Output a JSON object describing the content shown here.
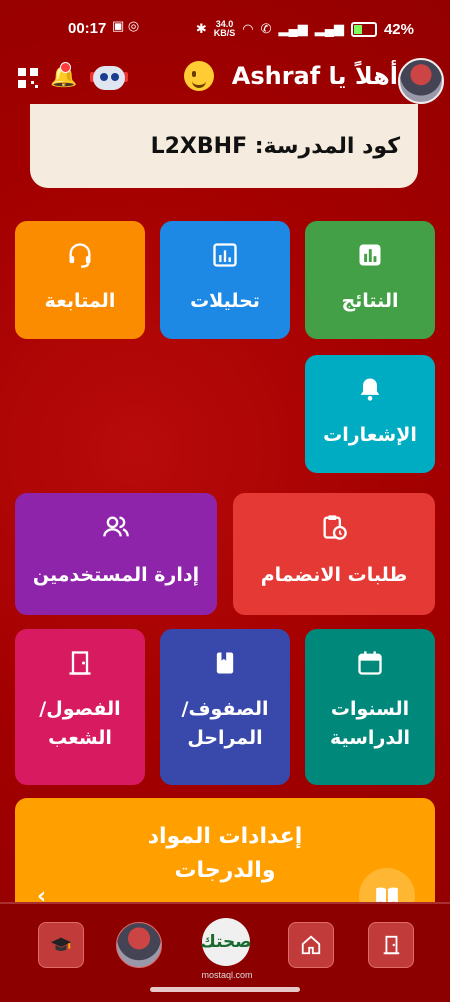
{
  "status_bar": {
    "time": "00:17",
    "speed": "34.0",
    "speed_unit": "KB/S",
    "battery": "42%"
  },
  "header": {
    "greeting": "أهلاً يا Ashraf"
  },
  "school": {
    "code_text": "كود المدرسة: L2XBHF"
  },
  "tiles": {
    "results": {
      "label": "النتائج",
      "color": "#43a047",
      "icon": "bar-chart-icon"
    },
    "analytics": {
      "label": "تحليلات",
      "color": "#1e88e5",
      "icon": "analytics-icon"
    },
    "followup": {
      "label": "المتابعة",
      "color": "#fb8c00",
      "icon": "headset-icon"
    },
    "notifications": {
      "label": "الإشعارات",
      "color": "#00acc1",
      "icon": "bell-icon"
    },
    "join_requests": {
      "label": "طلبات الانضمام",
      "color": "#e53935",
      "icon": "clipboard-clock-icon"
    },
    "user_management": {
      "label": "إدارة المستخدمين",
      "color": "#8e24aa",
      "icon": "users-icon"
    },
    "academic_years": {
      "line1": "السنوات",
      "line2": "الدراسية",
      "color": "#00897b",
      "icon": "calendar-icon"
    },
    "grades_stages": {
      "line1": "الصفوف/",
      "line2": "المراحل",
      "color": "#3949ab",
      "icon": "book-icon"
    },
    "classes_sections": {
      "line1": "الفصول/",
      "line2": "الشعب",
      "color": "#d81b60",
      "icon": "door-icon"
    },
    "subjects_settings": {
      "line1": "إعدادات المواد",
      "line2": "والدرجات",
      "color": "#ffa000",
      "icon": "open-book-icon"
    }
  },
  "bottom_nav": {
    "items": [
      "graduation-cap-icon",
      "profile-avatar",
      "app-logo",
      "home-icon",
      "logout-door-icon"
    ],
    "logo_text": "صحتك",
    "logo_sub": "mostaql.com"
  }
}
